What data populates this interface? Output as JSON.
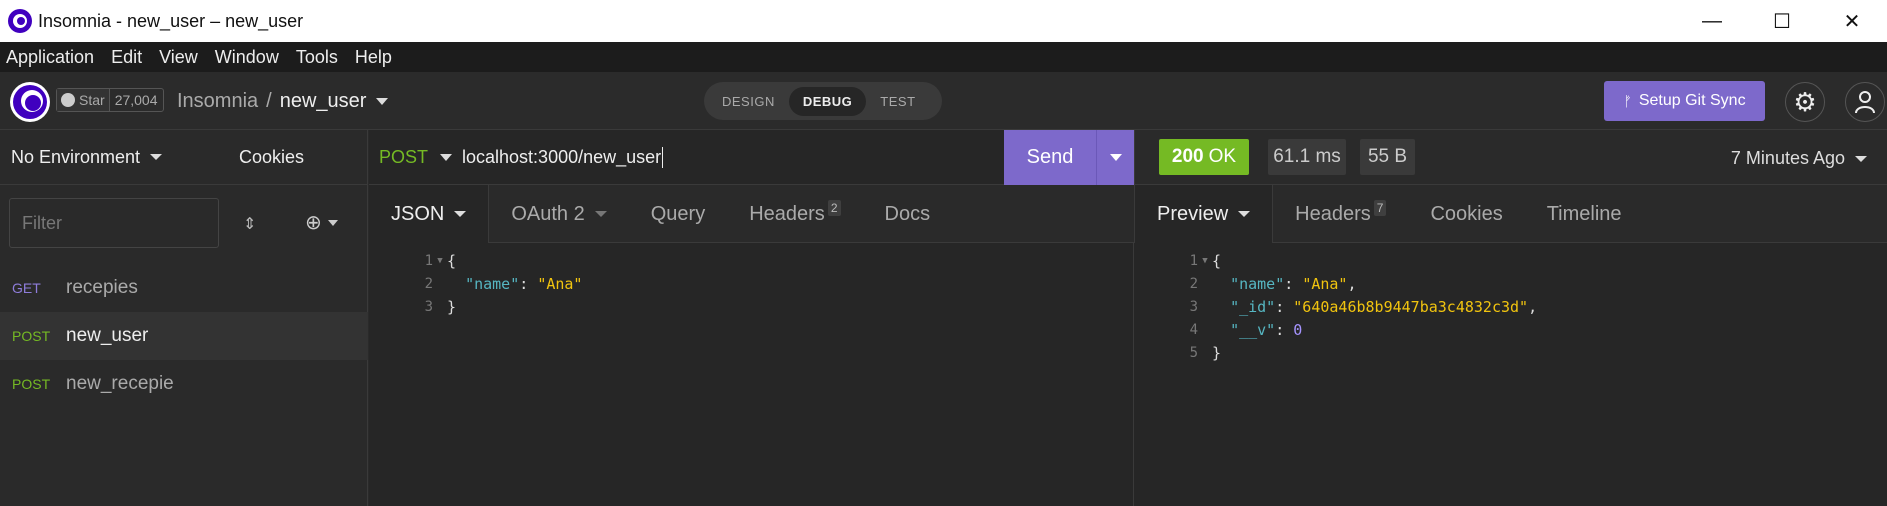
{
  "window": {
    "title": "Insomnia - new_user – new_user",
    "minimize": "—",
    "maximize": "☐",
    "close": "✕"
  },
  "menu": [
    "Application",
    "Edit",
    "View",
    "Window",
    "Tools",
    "Help"
  ],
  "header": {
    "github": {
      "star_label": "Star",
      "star_count": "27,004"
    },
    "breadcrumb": {
      "project": "Insomnia",
      "separator": "/",
      "request": "new_user"
    },
    "modes": [
      "DESIGN",
      "DEBUG",
      "TEST"
    ],
    "active_mode": "DEBUG",
    "git_sync_label": "Setup Git Sync",
    "git_sync_icon": "ᚠ",
    "settings_icon": "⚙",
    "user_icon": "⚲"
  },
  "sidebar": {
    "environment": "No Environment",
    "cookies_label": "Cookies",
    "filter_placeholder": "Filter",
    "sort_icon": "⇕",
    "add_icon": "⊕",
    "requests": [
      {
        "method": "GET",
        "name": "recepies"
      },
      {
        "method": "POST",
        "name": "new_user"
      },
      {
        "method": "POST",
        "name": "new_recepie"
      }
    ]
  },
  "request": {
    "method": "POST",
    "url": "localhost:3000/new_user",
    "send_label": "Send",
    "tabs": [
      {
        "label": "JSON"
      },
      {
        "label": "OAuth 2"
      },
      {
        "label": "Query"
      },
      {
        "label": "Headers",
        "badge": "2"
      },
      {
        "label": "Docs"
      }
    ],
    "body_lines": [
      {
        "n": "1",
        "text": "{"
      },
      {
        "n": "2",
        "key": "\"name\"",
        "value": "\"Ana\""
      },
      {
        "n": "3",
        "text": "}"
      }
    ]
  },
  "response": {
    "status_code": "200",
    "status_text": "OK",
    "time": "61.1 ms",
    "size": "55 B",
    "ago": "7 Minutes Ago",
    "tabs": [
      {
        "label": "Preview"
      },
      {
        "label": "Headers",
        "badge": "7"
      },
      {
        "label": "Cookies"
      },
      {
        "label": "Timeline"
      }
    ],
    "body_lines": [
      {
        "n": "1",
        "text": "{"
      },
      {
        "n": "2",
        "key": "\"name\"",
        "value": "\"Ana\""
      },
      {
        "n": "3",
        "key": "\"_id\"",
        "value": "\"640a46b8b9447ba3c4832c3d\""
      },
      {
        "n": "4",
        "key": "\"__v\"",
        "value": "0"
      },
      {
        "n": "5",
        "text": "}"
      }
    ]
  }
}
